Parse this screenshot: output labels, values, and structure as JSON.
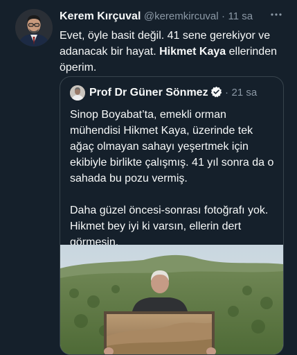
{
  "tweet": {
    "author_name": "Kerem Kırçuval",
    "handle": "@keremkircuval",
    "separator": "·",
    "time": "11 sa",
    "text_part1": "Evet, öyle basit değil. 41 sene gerekiyor ve adanacak bir hayat.",
    "text_bold": "Hikmet Kaya",
    "text_part2": "ellerinden öperim.",
    "more_icon": "more-horizontal-icon"
  },
  "quoted_tweet": {
    "author_name": "Prof Dr Güner Sönmez",
    "verified_icon": "verified-badge-icon",
    "separator": "·",
    "time": "21 sa",
    "paragraph1": "Sinop Boyabat’ta, emekli orman mühendisi Hikmet Kaya, üzerinde tek ağaç olmayan sahayı yeşertmek için ekibiyle birlikte çalışmış. 41 yıl sonra da o sahada bu pozu vermiş.",
    "paragraph2": "Daha güzel öncesi-sonrası fotoğrafı yok. Hikmet bey iyi ki varsın, ellerin dert görmesin."
  },
  "colors": {
    "background": "#15202b",
    "text": "#f7f9f9",
    "secondary_text": "#8b98a5",
    "border": "#38444d",
    "verified": "#1d9bf0"
  }
}
